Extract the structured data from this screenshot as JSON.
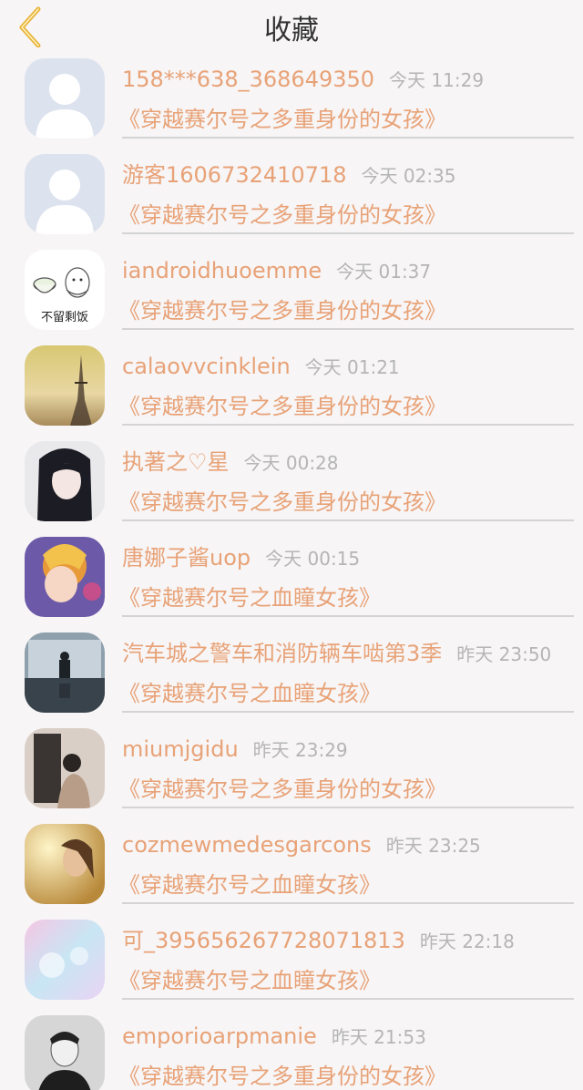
{
  "header": {
    "title": "收藏",
    "back_icon": "chevron-left-icon",
    "accent_color": "#e8b33a"
  },
  "colors": {
    "name": "#e8a277",
    "time": "#b5b5b5",
    "background": "#f7f5f6"
  },
  "favorites": [
    {
      "user": "158***638_368649350",
      "time": "今天 11:29",
      "book": "《穿越赛尔号之多重身份的女孩》",
      "avatar": "default-avatar"
    },
    {
      "user": "游客1606732410718",
      "time": "今天 02:35",
      "book": "《穿越赛尔号之多重身份的女孩》",
      "avatar": "default-avatar"
    },
    {
      "user": "iandroidhuoemme",
      "time": "今天 01:37",
      "book": "《穿越赛尔号之多重身份的女孩》",
      "avatar": "cartoon-avatar",
      "avatar_text": "不留剩饭"
    },
    {
      "user": "calaovvcinklein",
      "time": "今天 01:21",
      "book": "《穿越赛尔号之多重身份的女孩》",
      "avatar": "eiffel-tower-avatar"
    },
    {
      "user": "执著之♡星",
      "time": "今天 00:28",
      "book": "《穿越赛尔号之多重身份的女孩》",
      "avatar": "anime-girl-avatar"
    },
    {
      "user": "唐娜子酱uop",
      "time": "今天 00:15",
      "book": "《穿越赛尔号之血瞳女孩》",
      "avatar": "anime-character-avatar"
    },
    {
      "user": "汽车城之警车和消防辆车啮第3季",
      "time": "昨天 23:50",
      "book": "《穿越赛尔号之血瞳女孩》",
      "avatar": "silhouette-window-avatar"
    },
    {
      "user": "miumjgidu",
      "time": "昨天 23:29",
      "book": "《穿越赛尔号之多重身份的女孩》",
      "avatar": "woman-photo-avatar"
    },
    {
      "user": "cozmewmedesgarcons",
      "time": "昨天 23:25",
      "book": "《穿越赛尔号之血瞳女孩》",
      "avatar": "golden-portrait-avatar"
    },
    {
      "user": "可_395656267728071813",
      "time": "昨天 22:18",
      "book": "《穿越赛尔号之血瞳女孩》",
      "avatar": "pastel-sky-avatar"
    },
    {
      "user": "emporioarpmanie",
      "time": "昨天 21:53",
      "book": "《穿越赛尔号之多重身份的女孩》",
      "avatar": "bw-portrait-avatar"
    }
  ]
}
